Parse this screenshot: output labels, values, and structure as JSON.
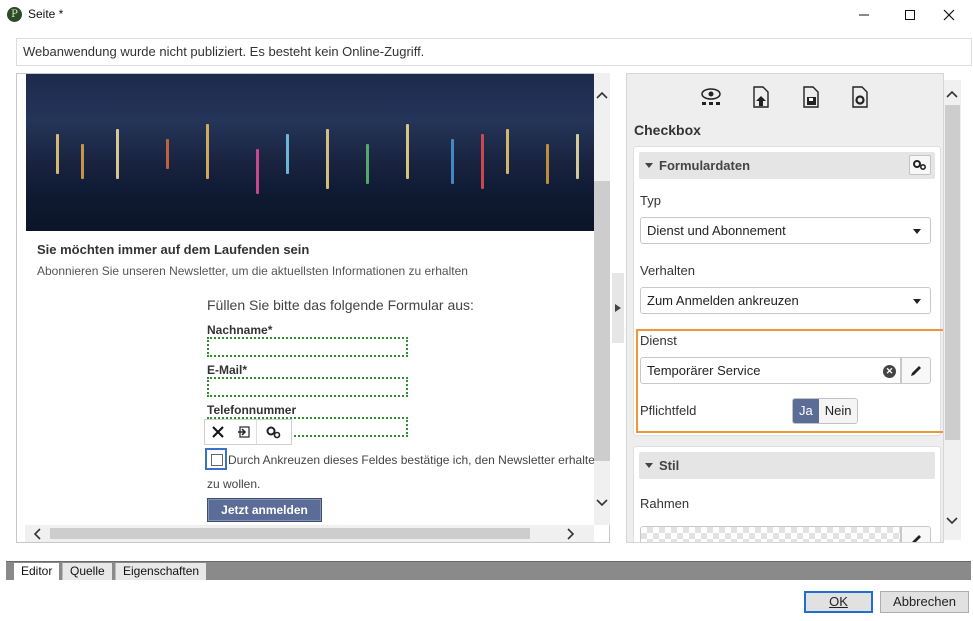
{
  "window": {
    "title": "Seite *",
    "app_icon_glyph": "P"
  },
  "banner": {
    "text": "Webanwendung wurde nicht publiziert. Es besteht kein Online-Zugriff."
  },
  "preview": {
    "heading": "Sie möchten immer auf dem Laufenden sein",
    "subheading": "Abonnieren Sie unseren Newsletter, um die aktuellsten Informationen zu erhalten",
    "form_intro": "Füllen Sie bitte das folgende Formular aus:",
    "fields": {
      "lastname_label": "Nachname*",
      "email_label": "E-Mail*",
      "phone_label": "Telefonnummer"
    },
    "checkbox_text": "Durch Ankreuzen dieses Feldes bestätige ich, den Newsletter erhalten",
    "checkbox_text_cont": "zu wollen.",
    "submit_label": "Jetzt anmelden"
  },
  "panel": {
    "title": "Checkbox",
    "tools": [
      "eye-icon",
      "document-upload-icon",
      "document-save-icon",
      "document-settings-icon"
    ],
    "formulardaten": {
      "header": "Formulardaten",
      "typ_label": "Typ",
      "typ_value": "Dienst und Abonnement",
      "verhalten_label": "Verhalten",
      "verhalten_value": "Zum Anmelden ankreuzen",
      "dienst_label": "Dienst",
      "dienst_value": "Temporärer Service",
      "pflichtfeld_label": "Pflichtfeld",
      "yes_label": "Ja",
      "no_label": "Nein",
      "pflichtfeld_selected": "Ja"
    },
    "stil": {
      "header": "Stil",
      "rahmen_label": "Rahmen"
    }
  },
  "tabs": [
    "Editor",
    "Quelle",
    "Eigenschaften"
  ],
  "active_tab": "Editor",
  "buttons": {
    "ok": "OK",
    "cancel": "Abbrechen"
  },
  "colors": {
    "accent": "#5b6d96",
    "highlight": "#f0963a",
    "selection": "#3a72c8",
    "field_outline": "#2f8f2f"
  }
}
